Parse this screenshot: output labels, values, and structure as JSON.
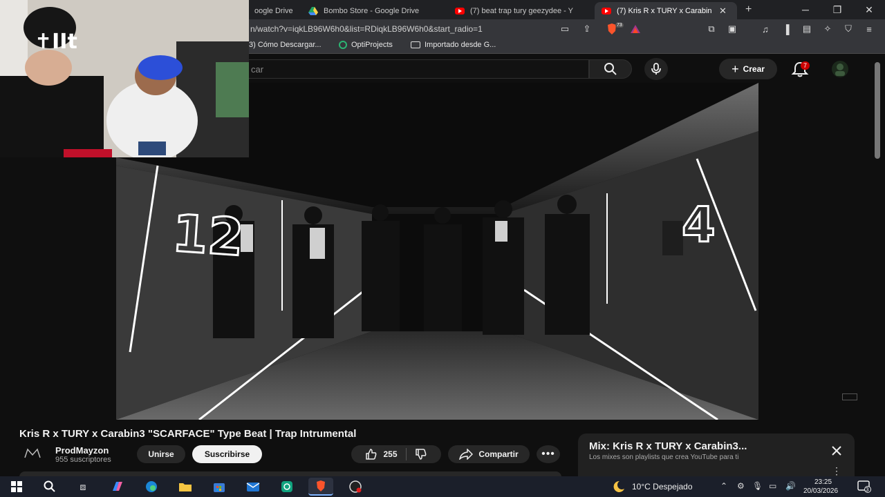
{
  "browser": {
    "tabs": [
      {
        "label": "oogle Drive",
        "icon": "google-drive-icon"
      },
      {
        "label": "Bombo Store - Google Drive",
        "icon": "google-drive-icon"
      },
      {
        "label": "(7) beat trap tury geezydee - Y",
        "icon": "youtube-icon"
      },
      {
        "label": "(7) Kris R x TURY x Carabin",
        "icon": "youtube-icon",
        "active": true
      }
    ],
    "url": "n/watch?v=iqkLB96W6h0&list=RDiqkLB96W6h0&start_radio=1",
    "shield_badge": "73",
    "bookmarks": [
      {
        "label": "3) Cómo Descargar..."
      },
      {
        "label": "OptiProjects"
      },
      {
        "label": "Importado desde G..."
      }
    ]
  },
  "youtube": {
    "search_placeholder": "car",
    "create_label": "Crear",
    "notifications_count": "7",
    "video": {
      "title": "Kris R x TURY x Carabin3 \"SCARFACE\" Type Beat | Trap Intrumental",
      "channel_name": "ProdMayzon",
      "subscribers": "955 suscriptores",
      "join_label": "Unirse",
      "subscribe_label": "Suscribirse",
      "likes": "255",
      "share_label": "Compartir",
      "wall_numbers": [
        "12",
        "4"
      ]
    },
    "mix": {
      "title": "Mix: Kris R x TURY x Carabin3...",
      "subtitle": "Los mixes son playlists que crea YouTube para ti"
    }
  },
  "taskbar": {
    "weather": "10°C  Despejado",
    "time": "23:25",
    "date": "20/03/2026",
    "notification_count": "3"
  },
  "colors": {
    "youtube_red": "#ff0000",
    "background": "#0f0f0f",
    "chip": "#272727",
    "taskbar": "#1b1f2a"
  }
}
